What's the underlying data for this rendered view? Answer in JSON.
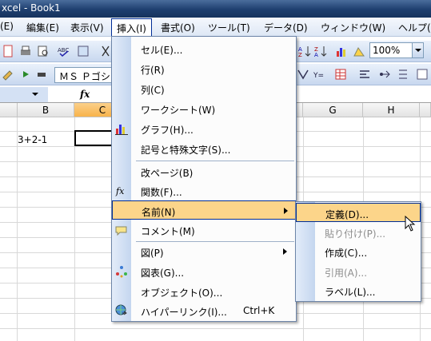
{
  "title": "xcel - Book1",
  "menubar": [
    {
      "label": "(E)"
    },
    {
      "label": "編集(E)"
    },
    {
      "label": "表示(V)"
    },
    {
      "label": "挿入(I)"
    },
    {
      "label": "書式(O)"
    },
    {
      "label": "ツール(T)"
    },
    {
      "label": "データ(D)"
    },
    {
      "label": "ウィンドウ(W)"
    },
    {
      "label": "ヘルプ("
    }
  ],
  "toolbar": {
    "zoom": "100%",
    "font": "ＭＳ Ｐゴシ"
  },
  "formula_bar": {
    "fx": "fx"
  },
  "columns": [
    "B",
    "C",
    "G",
    "H"
  ],
  "cells": {
    "b_row2": "3+2-1"
  },
  "insert_menu": {
    "items": [
      {
        "label": "セル(E)...",
        "icon": ""
      },
      {
        "label": "行(R)",
        "icon": ""
      },
      {
        "label": "列(C)",
        "icon": ""
      },
      {
        "label": "ワークシート(W)",
        "icon": ""
      },
      {
        "label": "グラフ(H)...",
        "icon": "chart-icon"
      },
      {
        "label": "記号と特殊文字(S)...",
        "icon": ""
      },
      {
        "label": "改ページ(B)",
        "icon": ""
      },
      {
        "label": "関数(F)...",
        "icon": "function-icon"
      },
      {
        "label": "名前(N)",
        "icon": "",
        "submenu": true,
        "highlighted": true
      },
      {
        "label": "コメント(M)",
        "icon": "comment-icon"
      },
      {
        "label": "図(P)",
        "icon": "",
        "submenu": true
      },
      {
        "label": "図表(G)...",
        "icon": "diagram-icon"
      },
      {
        "label": "オブジェクト(O)...",
        "icon": ""
      },
      {
        "label": "ハイパーリンク(I)...",
        "icon": "hyperlink-icon",
        "shortcut": "Ctrl+K"
      }
    ]
  },
  "name_submenu": {
    "items": [
      {
        "label": "定義(D)...",
        "highlighted": true,
        "disabled": false
      },
      {
        "label": "貼り付け(P)...",
        "disabled": true
      },
      {
        "label": "作成(C)...",
        "disabled": false
      },
      {
        "label": "引用(A)...",
        "disabled": true
      },
      {
        "label": "ラベル(L)...",
        "disabled": false
      }
    ]
  },
  "colors": {
    "highlight": "#fcd58a",
    "highlight_border": "#002d96",
    "selected_col": "#f8b34b"
  }
}
